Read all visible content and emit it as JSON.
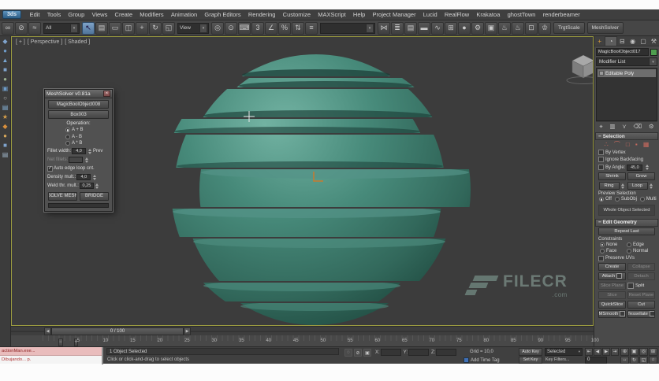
{
  "glyphs": {
    "minus": "−",
    "close": "×",
    "dropdown": "▾",
    "check": "✓",
    "left_arrow": "◀",
    "right_arrow": "▶",
    "plus": "+"
  },
  "colors": {
    "sphere": "#3e8170",
    "viewport_border": "#9a9a40",
    "object_swatch": "#4f9e4f",
    "watermark": "#93aca3",
    "subobject_red": "#c96a5e"
  },
  "menu": {
    "logo": "3ds",
    "items": [
      "Edit",
      "Tools",
      "Group",
      "Views",
      "Create",
      "Modifiers",
      "Animation",
      "Graph Editors",
      "Rendering",
      "Customize",
      "MAXScript",
      "Help",
      "Project Manager",
      "Lucid",
      "RealFlow",
      "Krakatoa",
      "ghostTown",
      "renderbeamer"
    ]
  },
  "toolbar": {
    "filter_dropdown": "All",
    "coord_dropdown": "View",
    "named_sel_dropdown": "",
    "icons_a": [
      {
        "name": "select-and-link-icon",
        "glyph": "∞"
      },
      {
        "name": "unlink-selection-icon",
        "glyph": "⊘"
      },
      {
        "name": "bind-to-space-warp-icon",
        "glyph": "≈"
      }
    ],
    "icons_b": [
      {
        "name": "select-object-icon",
        "glyph": "↖",
        "selected": true
      },
      {
        "name": "select-by-name-icon",
        "glyph": "▤"
      },
      {
        "name": "rectangular-selection-icon",
        "glyph": "▭"
      },
      {
        "name": "window-crossing-icon",
        "glyph": "◫"
      },
      {
        "name": "select-and-move-icon",
        "glyph": "+"
      },
      {
        "name": "select-and-rotate-icon",
        "glyph": "↻"
      },
      {
        "name": "select-and-scale-icon",
        "glyph": "◱"
      }
    ],
    "icons_c": [
      {
        "name": "use-pivot-center-icon",
        "glyph": "◎"
      },
      {
        "name": "select-and-manipulate-icon",
        "glyph": "⊙"
      },
      {
        "name": "keyboard-override-icon",
        "glyph": "⌨"
      },
      {
        "name": "snap-toggle-3d-icon",
        "glyph": "3"
      },
      {
        "name": "angle-snap-icon",
        "glyph": "∠"
      },
      {
        "name": "percent-snap-icon",
        "glyph": "%"
      },
      {
        "name": "spinner-snap-icon",
        "glyph": "⇅"
      },
      {
        "name": "edit-named-selections-icon",
        "glyph": "≡"
      }
    ],
    "icons_d": [
      {
        "name": "mirror-icon",
        "glyph": "⋈"
      },
      {
        "name": "align-icon",
        "glyph": "≣"
      },
      {
        "name": "layer-manager-icon",
        "glyph": "▤"
      },
      {
        "name": "ribbon-toggle-icon",
        "glyph": "▬"
      },
      {
        "name": "curve-editor-icon",
        "glyph": "∿"
      },
      {
        "name": "schematic-view-icon",
        "glyph": "⊞"
      },
      {
        "name": "material-editor-icon",
        "glyph": "●"
      },
      {
        "name": "render-setup-icon",
        "glyph": "⚙"
      },
      {
        "name": "rendered-frame-icon",
        "glyph": "▣"
      },
      {
        "name": "render-production-icon",
        "glyph": "♨"
      },
      {
        "name": "render-iterative-icon",
        "glyph": "♨"
      },
      {
        "name": "scene-explorer-icon",
        "glyph": "⊡"
      },
      {
        "name": "asset-tracking-icon",
        "glyph": "♔"
      }
    ],
    "text_buttons": [
      {
        "name": "trgtscale-button",
        "label": "TrgtScale"
      },
      {
        "name": "meshsolver-button",
        "label": "MeshSolver"
      }
    ]
  },
  "left_toolbar": {
    "icons": [
      {
        "name": "left-toolbar-icon",
        "glyph": "◆",
        "color": "#7fa3cc"
      },
      {
        "name": "left-toolbar-icon",
        "glyph": "●",
        "color": "#6f9cc9"
      },
      {
        "name": "left-toolbar-icon",
        "glyph": "▲",
        "color": "#79a7d4"
      },
      {
        "name": "left-toolbar-icon",
        "glyph": "■",
        "color": "#7fa3cc"
      },
      {
        "name": "left-toolbar-icon",
        "glyph": "●",
        "color": "#9ab08f"
      },
      {
        "name": "left-toolbar-icon",
        "glyph": "▣",
        "color": "#6f9cc9"
      },
      {
        "name": "left-toolbar-icon",
        "glyph": "○",
        "color": "#b9b9b9"
      },
      {
        "name": "left-toolbar-icon",
        "glyph": "▤",
        "color": "#87b3d9"
      },
      {
        "name": "left-toolbar-icon",
        "glyph": "★",
        "color": "#d9a04a"
      },
      {
        "name": "left-toolbar-icon",
        "glyph": "◆",
        "color": "#d98f3c"
      },
      {
        "name": "left-toolbar-icon",
        "glyph": "●",
        "color": "#d9a85a"
      },
      {
        "name": "left-toolbar-icon",
        "glyph": "■",
        "color": "#7fa3cc"
      },
      {
        "name": "left-toolbar-icon",
        "glyph": "▤",
        "color": "#9fb6c9"
      }
    ]
  },
  "viewport": {
    "labels": [
      "[ + ]",
      "[ Perspective ]",
      "[ Shaded ]"
    ]
  },
  "watermark": {
    "text": "FILECR",
    "tld": ".com"
  },
  "dialog": {
    "title": "MeshSolver v0.81a",
    "operand_a": "MagicBoolObject008",
    "operand_b": "Box003",
    "operation_label": "Operation:",
    "operations": [
      {
        "label": "A + B",
        "selected": true
      },
      {
        "label": "A - B"
      },
      {
        "label": "A * B"
      }
    ],
    "fillet_width_label": "Fillet width:",
    "fillet_width": "4,0",
    "prev_label": "Prev",
    "fillet_segs_label": "Net fillets:",
    "fillet_segs": "",
    "auto_edge_label": "Auto edge loop cnt.",
    "density_label": "Density mult.:",
    "density": "4,0",
    "weld_label": "Weld thr. mult.:",
    "weld": "0,25",
    "solve_label": "SOLVE MESH",
    "bridge_label": "BRIDGE"
  },
  "panel": {
    "tabs": [
      {
        "name": "tab-create",
        "glyph": "+",
        "color": "#d89c3c"
      },
      {
        "name": "tab-modify",
        "glyph": "◔",
        "selected": true
      },
      {
        "name": "tab-hierarchy",
        "glyph": "⊟"
      },
      {
        "name": "tab-motion",
        "glyph": "◉"
      },
      {
        "name": "tab-display",
        "glyph": "▢"
      },
      {
        "name": "tab-utilities",
        "glyph": "⚒"
      }
    ],
    "object_name": "MagicBoolObject017",
    "modifier_list": "Modifier List",
    "stack_items": [
      {
        "label": "Editable Poly",
        "selected": true
      }
    ],
    "stack_tools": [
      {
        "name": "pin-stack-icon",
        "glyph": "⌖"
      },
      {
        "name": "show-end-result-icon",
        "glyph": "▥"
      },
      {
        "name": "make-unique-icon",
        "glyph": "⋎"
      },
      {
        "name": "remove-modifier-icon",
        "glyph": "⌫"
      },
      {
        "name": "configure-modifier-sets-icon",
        "glyph": "⚙"
      }
    ],
    "selection": {
      "title": "Selection",
      "subobject_icons": [
        {
          "name": "vertex-icon",
          "glyph": "∴",
          "color": "#c96a5e"
        },
        {
          "name": "edge-icon",
          "glyph": "⌒",
          "color": "#c96a5e"
        },
        {
          "name": "border-icon",
          "glyph": "□",
          "color": "#c96a5e"
        },
        {
          "name": "polygon-icon",
          "glyph": "▪",
          "color": "#c96a5e"
        },
        {
          "name": "element-icon",
          "glyph": "▦",
          "color": "#c96a5e"
        }
      ],
      "checks": [
        {
          "label": "By Vertex"
        },
        {
          "label": "Ignore Backfacing"
        }
      ],
      "by_angle_label": "By Angle:",
      "by_angle_value": "45,0",
      "shrink": "Shrink",
      "grow": "Grow",
      "ring": "Ring",
      "loop": "Loop",
      "preview_label": "Preview Selection",
      "preview_options": [
        {
          "label": "Off",
          "selected": true
        },
        {
          "label": "SubObj"
        },
        {
          "label": "Multi"
        }
      ],
      "status": "Whole Object Selected"
    },
    "edit_geometry": {
      "title": "Edit Geometry",
      "repeat_last": "Repeat Last",
      "constraints_label": "Constraints",
      "constraints": [
        {
          "label": "None",
          "selected": true
        },
        {
          "label": "Edge"
        },
        {
          "label": "Face"
        },
        {
          "label": "Normal"
        }
      ],
      "preserve_uvs": "Preserve UVs",
      "buttons": [
        {
          "label": "Create"
        },
        {
          "label": "Collapse",
          "disabled": true
        },
        {
          "label": "Attach",
          "box": true
        },
        {
          "label": "Detach",
          "disabled": true
        },
        {
          "label": "Slice Plane",
          "disabled": true
        },
        {
          "label": "Split",
          "check": true
        },
        {
          "label": "Slice",
          "disabled": true
        },
        {
          "label": "Reset Plane",
          "disabled": true
        },
        {
          "label": "QuickSlice"
        },
        {
          "label": "Cut"
        },
        {
          "label": "MSmooth",
          "box": true
        },
        {
          "label": "Tessellate",
          "box": true
        }
      ]
    }
  },
  "timeline": {
    "slider": "0 / 100",
    "ticks": [
      "5",
      "10",
      "15",
      "20",
      "25",
      "30",
      "35",
      "40",
      "45",
      "50",
      "55",
      "60",
      "65",
      "70",
      "75",
      "80",
      "85",
      "90",
      "95",
      "100"
    ]
  },
  "status": {
    "listener_line1": "actionMan.exe...",
    "listener_line2": "Dibujando... p.",
    "selection_status": "1 Object Selected",
    "prompt": "Click or click-and-drag to select objects",
    "x_label": "X:",
    "y_label": "Y:",
    "z_label": "Z:",
    "grid": "Grid = 10,0",
    "add_time_tag": "Add Time Tag",
    "auto_key": "Auto Key",
    "set_key": "Set Key",
    "selected_dropdown": "Selected",
    "key_filters": "Key Filters...",
    "frame": "0",
    "mini_icons": [
      {
        "name": "isolate-selection-icon",
        "glyph": "◌"
      },
      {
        "name": "selection-lock-toggle-icon",
        "glyph": "⊘"
      },
      {
        "name": "absolute-mode-icon",
        "glyph": "▣"
      }
    ],
    "transport": [
      {
        "name": "go-to-start-icon",
        "glyph": "⇤"
      },
      {
        "name": "previous-frame-icon",
        "glyph": "◀"
      },
      {
        "name": "play-icon",
        "glyph": "▶"
      },
      {
        "name": "go-to-end-icon",
        "glyph": "⇥"
      }
    ],
    "nav": [
      {
        "name": "zoom-icon",
        "glyph": "⊕"
      },
      {
        "name": "zoom-extents-icon",
        "glyph": "▣"
      },
      {
        "name": "zoom-region-icon",
        "glyph": "◎"
      },
      {
        "name": "fov-icon",
        "glyph": "⊞"
      },
      {
        "name": "pan-icon",
        "glyph": "↔"
      },
      {
        "name": "orbit-icon",
        "glyph": "↻"
      },
      {
        "name": "maximize-viewport-icon",
        "glyph": "◱"
      },
      {
        "name": "zoom-all-icon",
        "glyph": "⌂"
      }
    ]
  }
}
